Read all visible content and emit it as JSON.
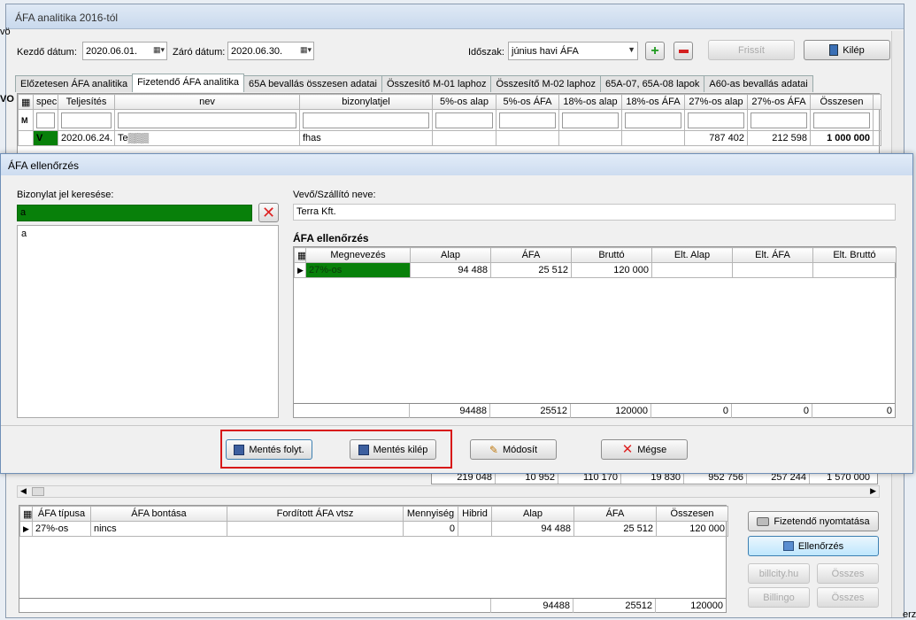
{
  "window_title": "ÁFA analitika 2016-tól",
  "top": {
    "start_label": "Kezdő dátum:",
    "start_value": "2020.06.01.",
    "end_label": "Záró dátum:",
    "end_value": "2020.06.30.",
    "period_label": "Időszak:",
    "period_value": "június havi ÁFA",
    "refresh": "Frissít",
    "exit": "Kilép"
  },
  "tabs": [
    "Előzetesen ÁFA analitika",
    "Fizetendő ÁFA analitika",
    "65A bevallás összesen adatai",
    "Összesítő M-01 laphoz",
    "Összesítő M-02 laphoz",
    "65A-07, 65A-08 lapok",
    "A60-as bevallás adatai"
  ],
  "main_grid": {
    "headers": [
      "spec",
      "Teljesítés",
      "nev",
      "bizonylatjel",
      "5%-os alap",
      "5%-os ÁFA",
      "18%-os alap",
      "18%-os ÁFA",
      "27%-os alap",
      "27%-os ÁFA",
      "Összesen"
    ],
    "row": [
      "V",
      "2020.06.24.",
      "Te▒▒▒",
      "fhas",
      "",
      "",
      "",
      "",
      "787 402",
      "212 598",
      "1 000 000"
    ],
    "totals": [
      "219 048",
      "10 952",
      "110 170",
      "19 830",
      "952 756",
      "257 244",
      "1 570 000"
    ]
  },
  "dialog": {
    "title": "ÁFA ellenőrzés",
    "search_label": "Bizonylat jel keresése:",
    "search_value": "a",
    "list_items": [
      "a"
    ],
    "partner_label": "Vevő/Szállító neve:",
    "partner_value": "Terra Kft.",
    "check_title": "ÁFA ellenőrzés",
    "check_headers": [
      "Megnevezés",
      "Alap",
      "ÁFA",
      "Bruttó",
      "Elt. Alap",
      "Elt. ÁFA",
      "Elt. Bruttó"
    ],
    "check_row": [
      "27%-os",
      "94 488",
      "25 512",
      "120 000",
      "",
      "",
      ""
    ],
    "check_totals": [
      "94488",
      "25512",
      "120000",
      "0",
      "0",
      "0"
    ],
    "buttons": {
      "save_continue": "Mentés folyt.",
      "save_exit": "Mentés kilép",
      "modify": "Módosít",
      "cancel": "Mégse"
    }
  },
  "bottom_grid": {
    "headers": [
      "ÁFA típusa",
      "ÁFA bontása",
      "Fordított ÁFA vtsz",
      "Mennyiség",
      "Hibrid",
      "Alap",
      "ÁFA",
      "Összesen"
    ],
    "row": [
      "27%-os",
      "nincs",
      "",
      "0",
      "",
      "94 488",
      "25 512",
      "120 000"
    ],
    "totals": [
      "94488",
      "25512",
      "120000"
    ]
  },
  "side_buttons": {
    "print": "Fizetendő nyomtatása",
    "check": "Ellenőrzés",
    "billcity": "billcity.hu",
    "billingo": "Billingo",
    "sum1": "Összes",
    "sum2": "Összes"
  },
  "left_edge_fragments": [
    "vö",
    "VO"
  ],
  "right_edge_fragment": "erz"
}
